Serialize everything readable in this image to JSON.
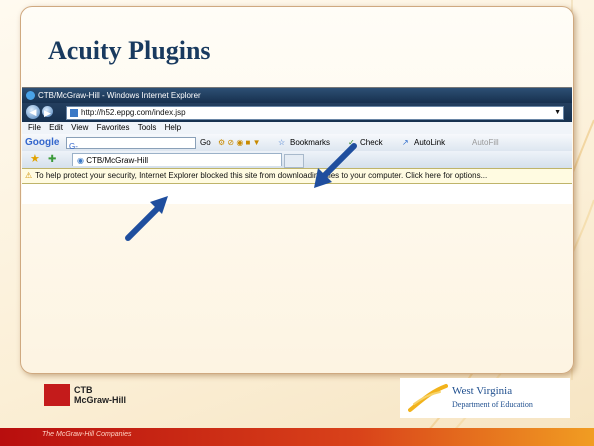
{
  "slide": {
    "title": "Acuity Plugins"
  },
  "browser": {
    "window_title": "CTB/McGraw-Hill - Windows Internet Explorer",
    "address_url": "http://h52.eppg.com/index.jsp",
    "menu": [
      "File",
      "Edit",
      "View",
      "Favorites",
      "Tools",
      "Help"
    ],
    "google_label": "Google",
    "google_box": "G-",
    "google_go": "Go",
    "bookmarks_label": "Bookmarks",
    "check_label": "Check",
    "autolink_label": "AutoLink",
    "autofill_label": "AutoFill",
    "tab_title": "CTB/McGraw-Hill",
    "info_message": "To help protect your security, Internet Explorer blocked this site from downloading files to your computer. Click here for options..."
  },
  "footer": {
    "left_logo": [
      "CTB",
      "McGraw-Hill"
    ],
    "right_logo": {
      "line1": "West Virginia",
      "line2": "Department of Education"
    },
    "tagline": "The McGraw-Hill Companies"
  },
  "colors": {
    "title": "#193a5f",
    "arrow": "#1f4e9e",
    "bar_red": "#b80e0e",
    "bar_orange": "#f19d22"
  }
}
